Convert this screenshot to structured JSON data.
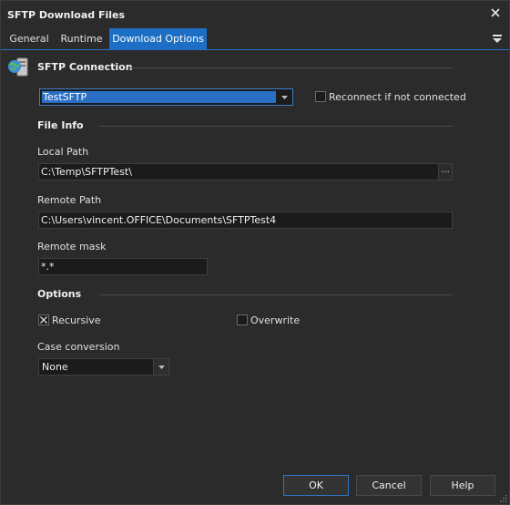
{
  "window": {
    "title": "SFTP Download Files"
  },
  "tabs": [
    {
      "label": "General"
    },
    {
      "label": "Runtime"
    },
    {
      "label": "Download Options"
    }
  ],
  "sftp": {
    "section_title": "SFTP Connection",
    "connection_value": "TestSFTP",
    "reconnect_label": "Reconnect if not connected",
    "reconnect_checked": false
  },
  "file_info": {
    "section_title": "File Info",
    "local_path_label": "Local Path",
    "local_path_value": "C:\\Temp\\SFTPTest\\",
    "browse_label": "...",
    "remote_path_label": "Remote Path",
    "remote_path_value": "C:\\Users\\vincent.OFFICE\\Documents\\SFTPTest4",
    "remote_mask_label": "Remote mask",
    "remote_mask_value": "*.*"
  },
  "options": {
    "section_title": "Options",
    "recursive_label": "Recursive",
    "recursive_checked": true,
    "overwrite_label": "Overwrite",
    "overwrite_checked": false,
    "case_conversion_label": "Case conversion",
    "case_conversion_value": "None"
  },
  "footer": {
    "ok_label": "OK",
    "cancel_label": "Cancel",
    "help_label": "Help"
  },
  "colors": {
    "accent": "#1c6fc4",
    "background": "#2b2b2b",
    "field_background": "#1b1b1b"
  },
  "icons": [
    "close-icon",
    "tab-menu-icon",
    "sftp-connection-icon",
    "chevron-down-icon",
    "check-icon",
    "resize-grip-icon"
  ]
}
